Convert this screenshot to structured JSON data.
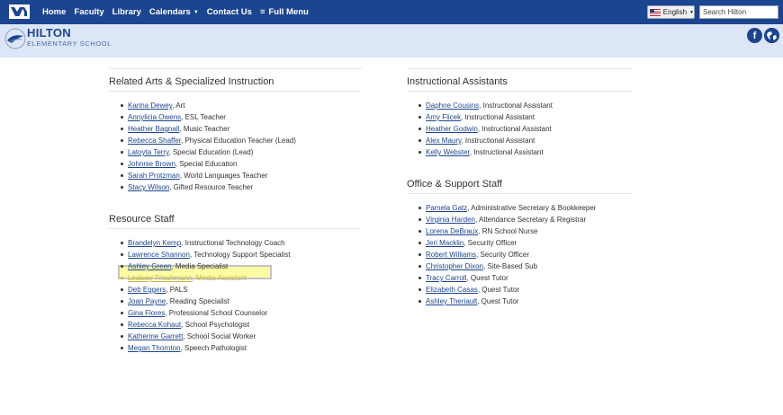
{
  "nav": {
    "items": [
      "Home",
      "Faculty",
      "Library",
      "Calendars",
      "Contact Us",
      "Full Menu"
    ],
    "language": "English",
    "search_placeholder": "Search Hilton"
  },
  "header": {
    "name_big": "HILTON",
    "name_small": "ELEMENTARY SCHOOL"
  },
  "sections": {
    "related_arts": {
      "title": "Related Arts & Specialized Instruction",
      "staff": [
        {
          "name": "Karina Dewey",
          "role": ", Art"
        },
        {
          "name": "Annylicia Owens",
          "role": ", ESL Teacher"
        },
        {
          "name": "Heather Bagnall",
          "role": ", Music Teacher"
        },
        {
          "name": "Rebecca Shaffer",
          "role": ", Physical Education Teacher (Lead)"
        },
        {
          "name": "Latoyta Terry",
          "role": ", Special Education (Lead)"
        },
        {
          "name": "Johnnie Brown",
          "role": ", Special Education"
        },
        {
          "name": "Sarah Protzman",
          "role": ", World Languages Teacher"
        },
        {
          "name": "Stacy Wilson",
          "role": ", Gifted Resource Teacher"
        }
      ]
    },
    "resource_staff": {
      "title": "Resource Staff",
      "staff": [
        {
          "name": "Brandelyn Kemp",
          "role": ", Instructional Technology Coach"
        },
        {
          "name": "Lawrence Shannon",
          "role": ", Technology Support Specialist"
        },
        {
          "name": "Ashley Green",
          "role": ", Media Specialist"
        },
        {
          "name": "Lindsay Trieshmann",
          "role": ", Media Assistant"
        },
        {
          "name": "Deb Eggers",
          "role": ", PALS"
        },
        {
          "name": "Joan Payne",
          "role": ", Reading Specialist"
        },
        {
          "name": "Gina Flores",
          "role": ", Professional School Counselor"
        },
        {
          "name": "Rebecca Kohaut",
          "role": ", School Psychologist"
        },
        {
          "name": "Katherine Garrett",
          "role": ", School Social Worker"
        },
        {
          "name": "Megan Thornton",
          "role": ", Speech Pathologist"
        }
      ]
    },
    "instructional_assistants": {
      "title": "Instructional Assistants",
      "staff": [
        {
          "name": "Daphne Cousins",
          "role": ", Instructional Assistant"
        },
        {
          "name": "Amy Flicek",
          "role": ", Instructional Assistant"
        },
        {
          "name": "Heather Godwin",
          "role": ", Instructional Assistant"
        },
        {
          "name": "Alex Maury",
          "role": ", Instructional Assistant"
        },
        {
          "name": "Kelly Webster",
          "role": ", Instructional Assistant"
        }
      ]
    },
    "office_support": {
      "title": "Office & Support Staff",
      "staff": [
        {
          "name": "Pamela Gatz",
          "role": ", Administrative Secretary & Bookkeeper"
        },
        {
          "name": "Virginia Harden",
          "role": ", Attendance Secretary & Registrar"
        },
        {
          "name": "Lorena DeBraux",
          "role": ", RN School Nurse"
        },
        {
          "name": "Jeri Macklin",
          "role": ", Security Officer"
        },
        {
          "name": "Robert Williams",
          "role": ", Security Officer"
        },
        {
          "name": "Christopher Dixon",
          "role": ", Site-Based Sub"
        },
        {
          "name": "Tracy Carroll",
          "role": ", Quest Tutor"
        },
        {
          "name": "Elizabeth Casas",
          "role": ", Quest Tutor"
        },
        {
          "name": "Ashley Theriault",
          "role": ", Quest Tutor"
        }
      ]
    }
  },
  "colors": {
    "nav_bg": "#1c4590",
    "band_bg": "#dde6f7",
    "link": "#1c4590",
    "highlight": "#fdfca4"
  },
  "icons": [
    "school-logo-icon",
    "caret-down-icon",
    "menu-icon",
    "us-flag-icon",
    "facebook-icon",
    "globe-icon"
  ]
}
